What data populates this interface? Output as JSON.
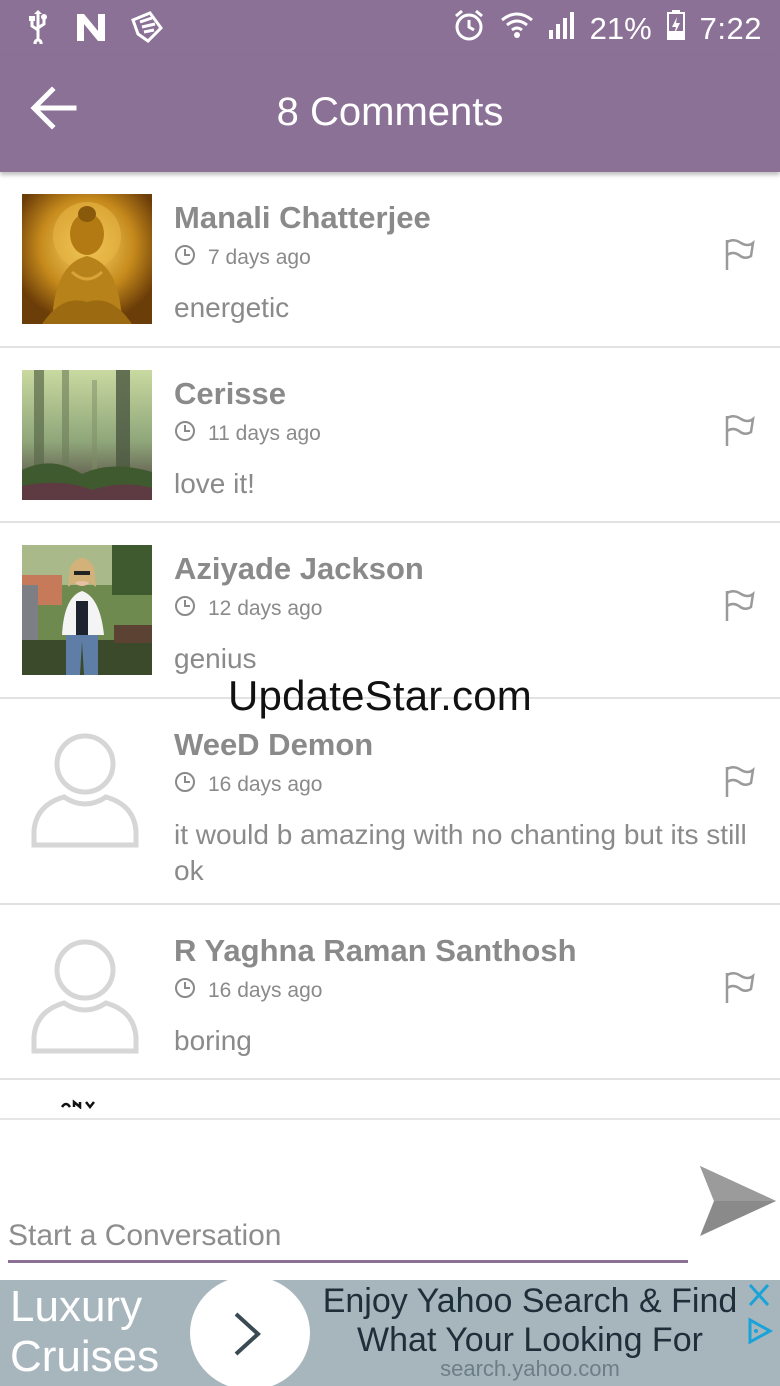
{
  "status_bar": {
    "battery": "21%",
    "time": "7:22",
    "left_icons": [
      "usb-icon",
      "n-notification-icon",
      "app-notification-icon"
    ],
    "right_icons": [
      "alarm-icon",
      "wifi-icon",
      "signal-icon",
      "battery-icon"
    ]
  },
  "app_bar": {
    "title": "8 Comments",
    "back_icon": "back-arrow-icon"
  },
  "comments": [
    {
      "name": "Manali Chatterjee",
      "time": "7 days ago",
      "text": "energetic",
      "avatar": "buddha-photo"
    },
    {
      "name": "Cerisse",
      "time": "11 days ago",
      "text": "love it!",
      "avatar": "forest-photo"
    },
    {
      "name": "Aziyade Jackson",
      "time": "12 days ago",
      "text": "genius",
      "avatar": "woman-photo"
    },
    {
      "name": "WeeD Demon",
      "time": "16 days ago",
      "text": "it would b amazing with no chanting but its still ok",
      "avatar": "default-user"
    },
    {
      "name": "R Yaghna Raman Santhosh",
      "time": "16 days ago",
      "text": "boring",
      "avatar": "default-user"
    }
  ],
  "watermark": "UpdateStar.com",
  "composer": {
    "placeholder": "Start a Conversation",
    "send_icon": "send-icon"
  },
  "ad": {
    "left_text": "Luxury Cruises",
    "headline": "Enjoy Yahoo Search & Find What Your Looking For",
    "url": "search.yahoo.com"
  },
  "colors": {
    "accent": "#8b7196",
    "text_gray": "#8a8a8a",
    "ad_background": "#a7b6bd"
  }
}
